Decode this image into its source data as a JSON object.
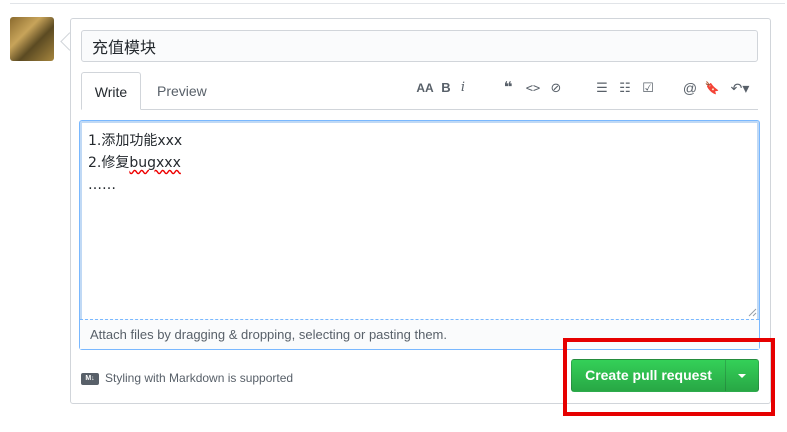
{
  "pr": {
    "title_value": "充值模块",
    "tabs": {
      "write": "Write",
      "preview": "Preview"
    },
    "toolbar": {
      "header": "AA",
      "bold": "B",
      "italic": "i",
      "quote": "❝",
      "code": "<>",
      "link": "⊘",
      "bullet_list": "☰",
      "numbered_list": "☷",
      "task_list": "☑",
      "mention": "@",
      "reference": "🔖",
      "reply": "↶▾"
    },
    "body_lines": [
      "1.添加功能xxx",
      "2.修复",
      "bugxxx",
      "……"
    ],
    "attach_text": "Attach files by dragging & dropping, selecting or pasting them.",
    "markdown_note": "Styling with Markdown is supported",
    "markdown_badge": "M↓",
    "create_button": "Create pull request"
  },
  "colors": {
    "primary_green": "#28a745",
    "focus_blue": "#79b8ff",
    "highlight_red": "#e60000"
  }
}
